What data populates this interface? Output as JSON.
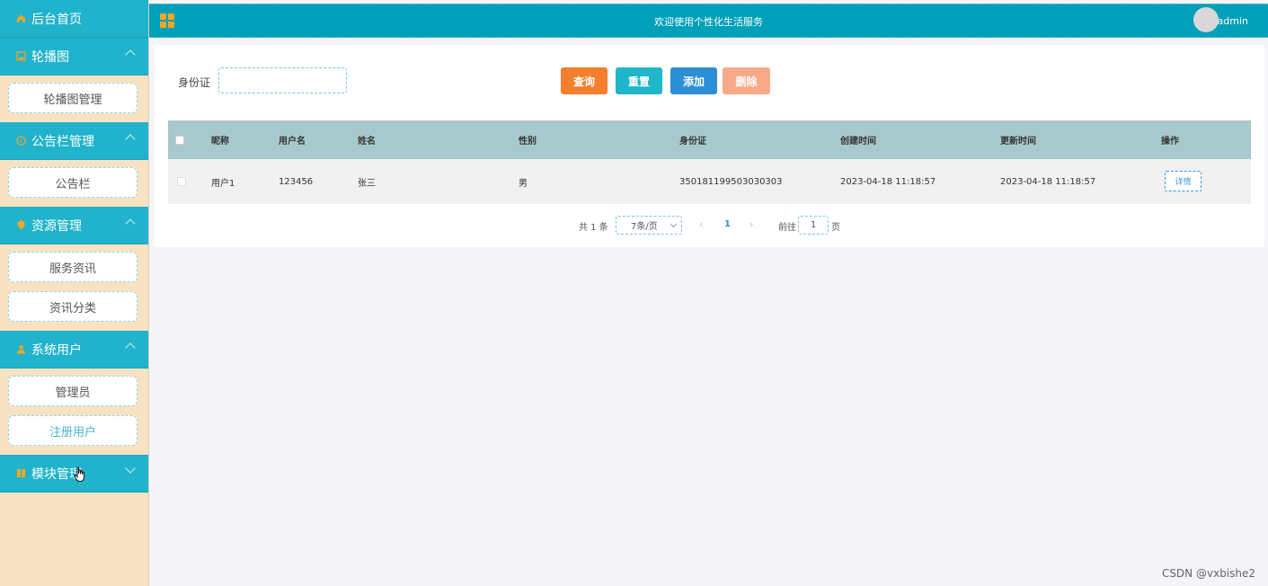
{
  "sidebar": {
    "home_label": "后台首页",
    "groups": [
      {
        "label": "轮播图",
        "items": [
          "轮播图管理"
        ]
      },
      {
        "label": "公告栏管理",
        "items": [
          "公告栏"
        ]
      },
      {
        "label": "资源管理",
        "items": [
          "服务资讯",
          "资讯分类"
        ]
      },
      {
        "label": "系统用户",
        "items": [
          "管理员",
          "注册用户"
        ]
      },
      {
        "label": "模块管理",
        "items": []
      }
    ]
  },
  "header": {
    "title": "欢迎使用个性化生活服务",
    "user": "admin"
  },
  "search": {
    "label": "身份证",
    "value": "",
    "placeholder": ""
  },
  "buttons": {
    "query": "查询",
    "reset": "重置",
    "add": "添加",
    "delete": "删除"
  },
  "table": {
    "headers": [
      "昵称",
      "用户名",
      "姓名",
      "性别",
      "身份证",
      "创建时间",
      "更新时间",
      "操作"
    ],
    "rows": [
      {
        "nickname": "用户1",
        "username": "123456",
        "name": "张三",
        "gender": "男",
        "id_card": "350181199503030303",
        "created": "2023-04-18 11:18:57",
        "updated": "2023-04-18 11:18:57",
        "action": "详情"
      }
    ]
  },
  "pager": {
    "total": "共 1 条",
    "page_size": "7条/页",
    "prev": "‹",
    "current": "1",
    "next": "›",
    "goto": "前往",
    "goto_value": "1",
    "page_suffix": "页"
  },
  "watermark": "CSDN @vxbishe2",
  "colors": {
    "sidebar_bg": "#f8e2c2",
    "menu_head": "#20b3cb",
    "topbar": "#00a0b8",
    "query": "#f57f2e",
    "reset": "#1fb6c9",
    "add": "#2a8fd4",
    "delete": "#f8a98a",
    "table_head": "#a7c9ce"
  }
}
